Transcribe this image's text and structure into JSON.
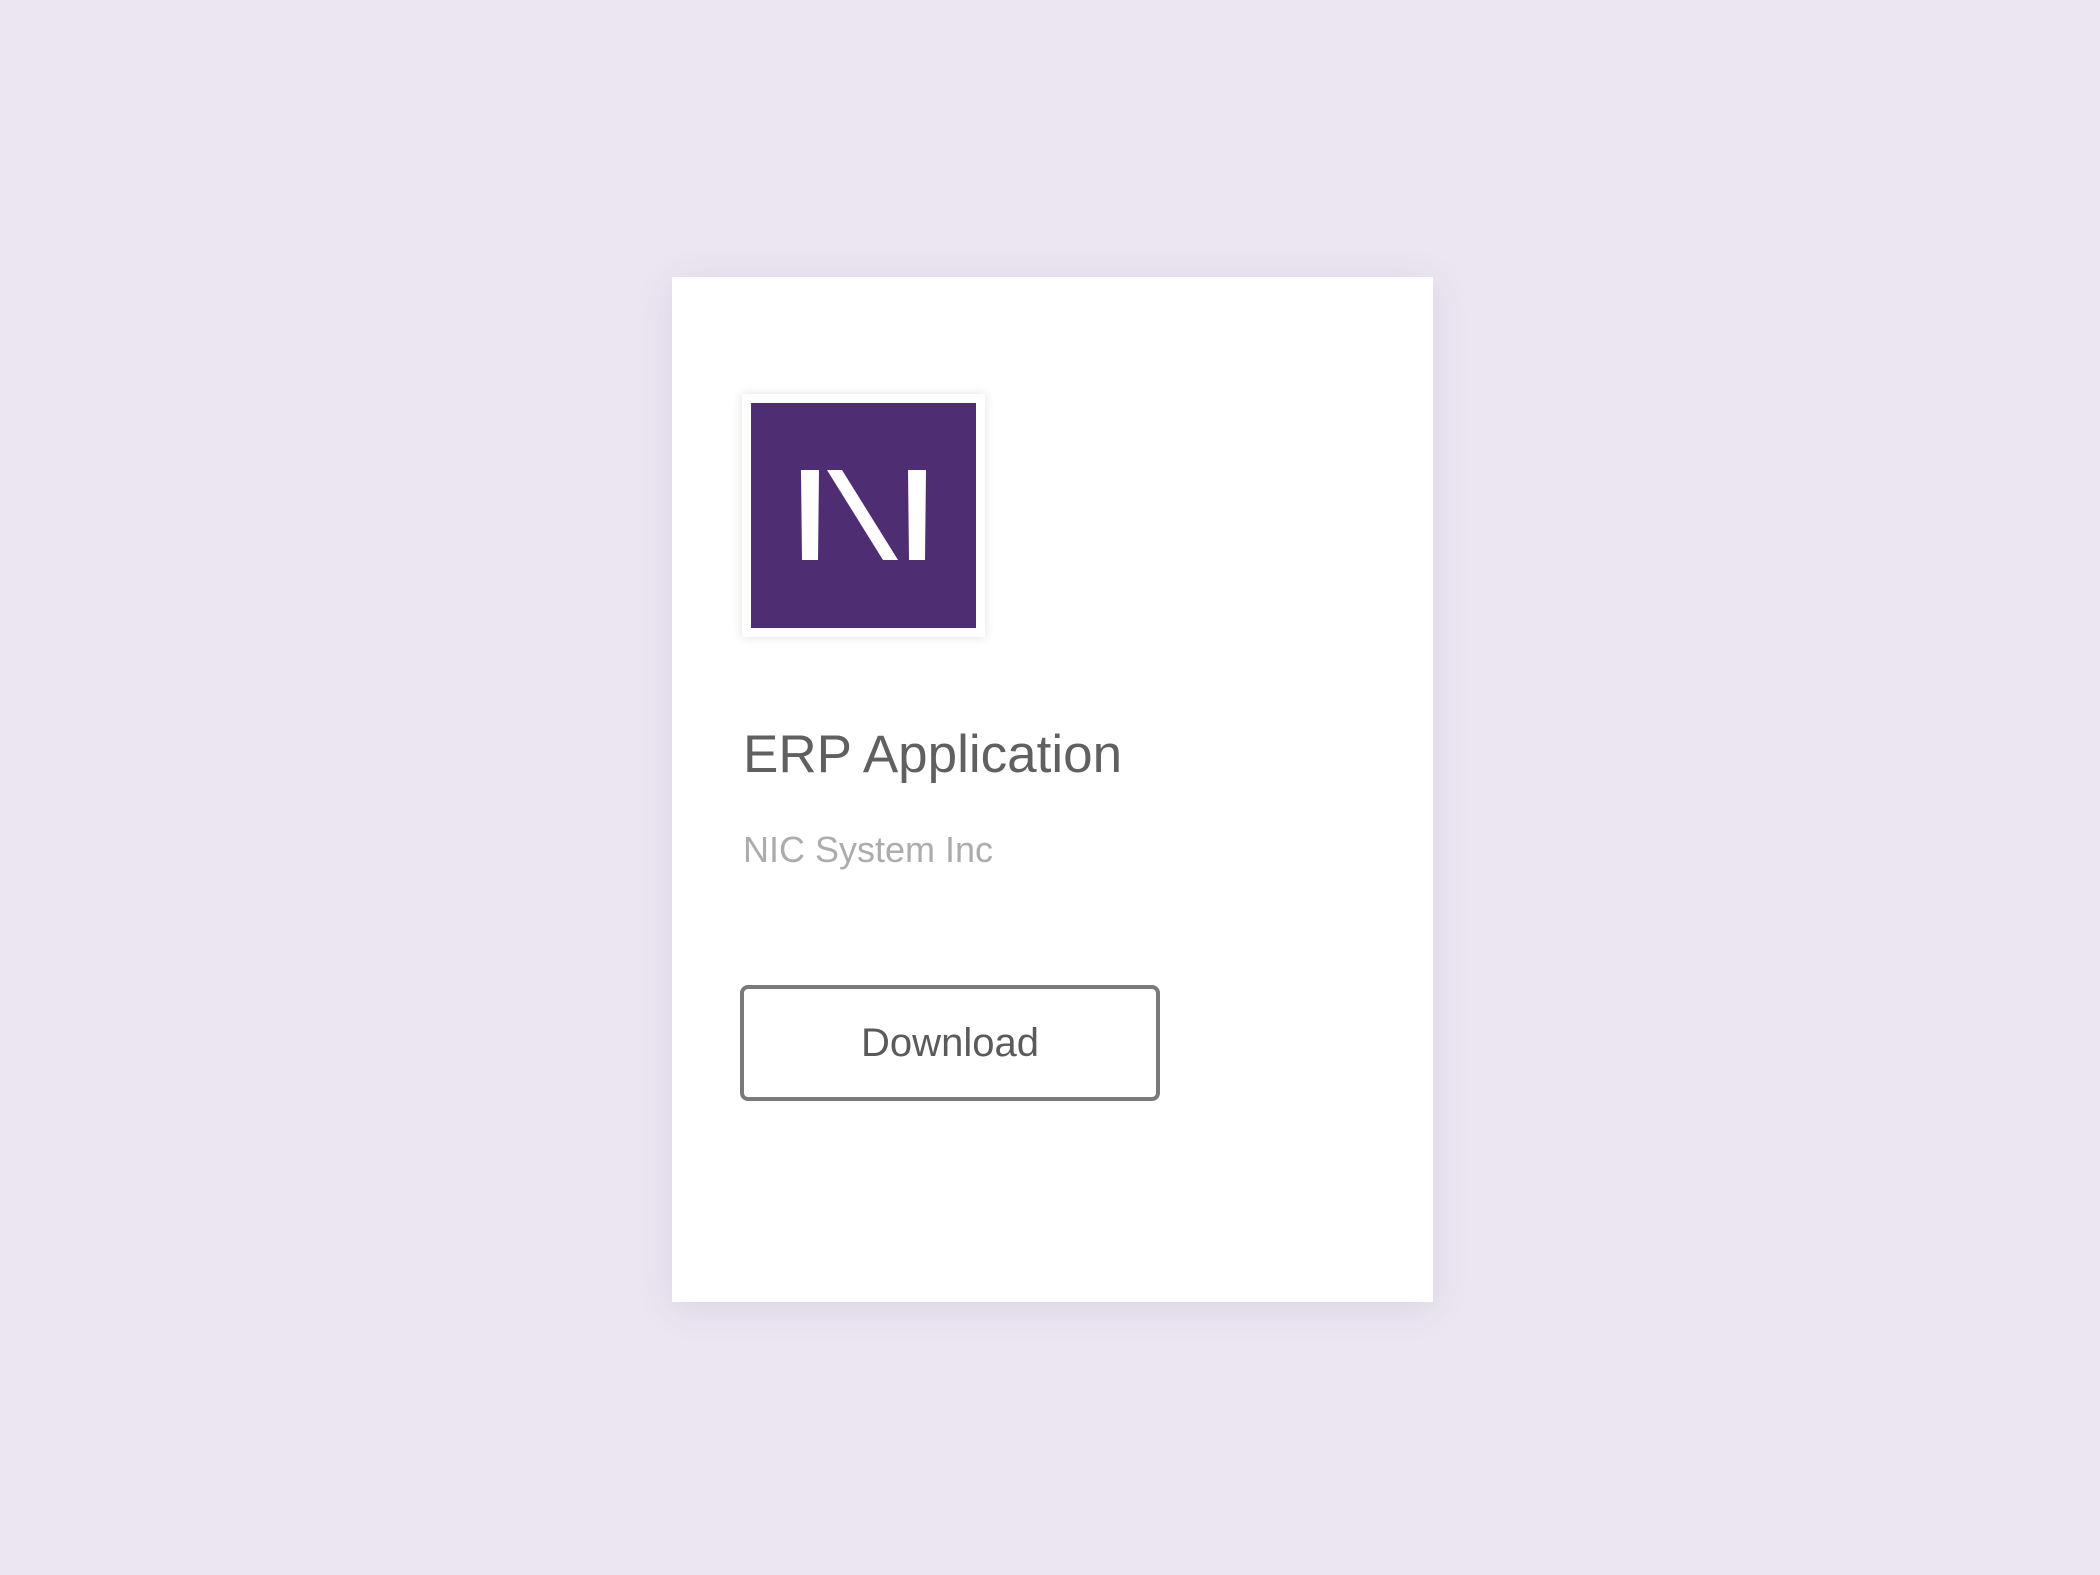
{
  "app": {
    "logo_icon": "nic-logo-icon",
    "title": "ERP Application",
    "vendor": "NIC System Inc",
    "download_label": "Download"
  },
  "colors": {
    "page_background": "#ece6f2",
    "card_background": "#ffffff",
    "brand_purple": "#4f2d73",
    "title_text": "#606060",
    "vendor_text": "#acacac",
    "button_border": "#7a7a7a"
  }
}
